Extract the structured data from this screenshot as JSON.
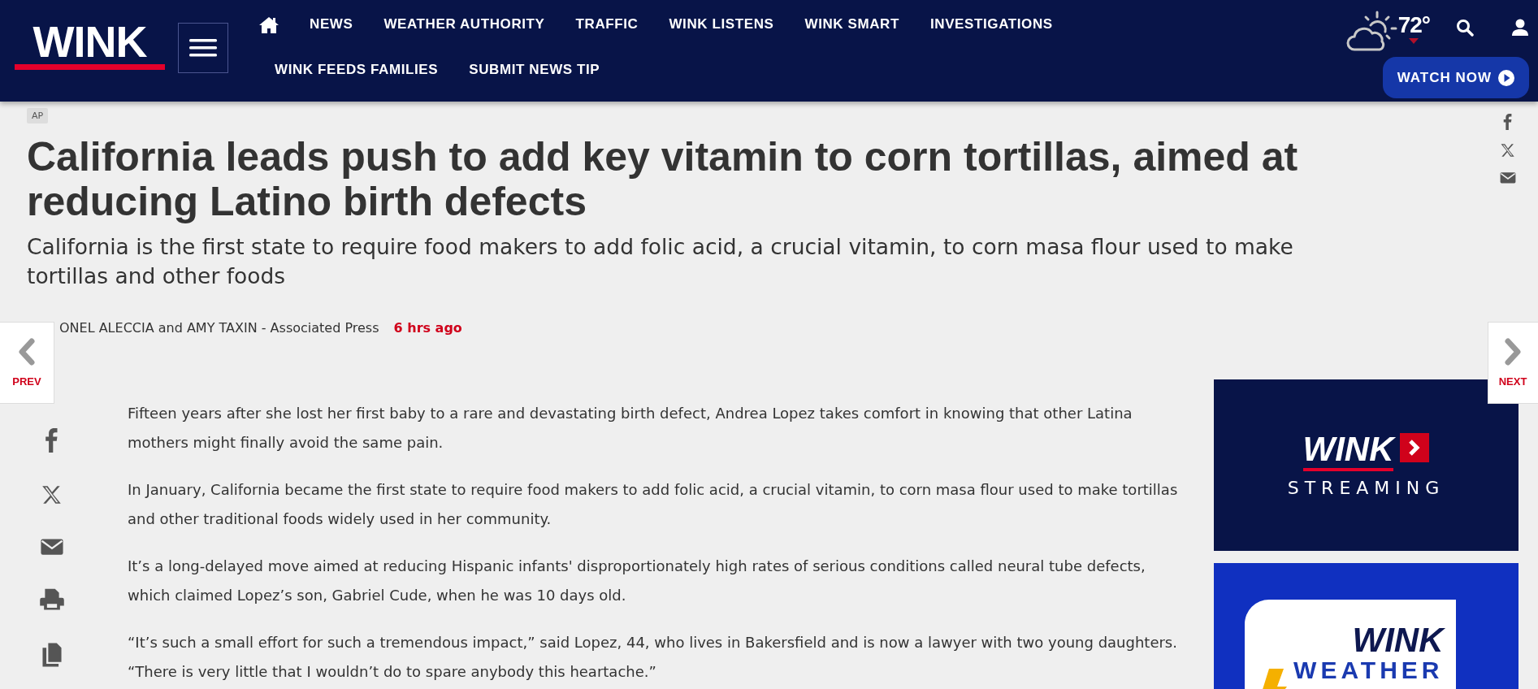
{
  "header": {
    "logo": "WINK",
    "nav": [
      "NEWS",
      "WEATHER AUTHORITY",
      "TRAFFIC",
      "WINK LISTENS",
      "WINK SMART",
      "INVESTIGATIONS",
      "WINK FEEDS FAMILIES",
      "SUBMIT NEWS TIP"
    ],
    "temperature": "72°",
    "watch_button": "WATCH NOW"
  },
  "article": {
    "tag": "AP",
    "headline": "California leads push to add key vitamin to corn tortillas, aimed at reducing Latino birth defects",
    "subtitle": "California is the first state to require food makers to add folic acid, a crucial vitamin, to corn masa flour used to make tortillas and other foods",
    "byline": "ONEL ALECCIA and AMY TAXIN - Associated Press",
    "time": "6 hrs ago",
    "paragraphs": [
      "Fifteen years after she lost her first baby to a rare and devastating birth defect, Andrea Lopez takes comfort in knowing that other Latina mothers might finally avoid the same pain.",
      "In January, California became the first state to require food makers to add folic acid, a crucial vitamin, to corn masa flour used to make tortillas and other traditional foods widely used in her community.",
      "It’s a long-delayed move aimed at reducing Hispanic infants' disproportionately high rates of serious conditions called neural tube defects, which claimed Lopez’s son, Gabriel Cude, when he was 10 days old.",
      "“It’s such a small effort for such a tremendous impact,” said Lopez, 44, who lives in Bakersfield and is now a lawyer with two young daughters. “There is very little that I wouldn’t do to spare anybody this heartache.”"
    ]
  },
  "pager": {
    "prev": "PREV",
    "next": "NEXT"
  },
  "ads": [
    {
      "kind": "streaming",
      "brand": "WINK",
      "label": "STREAMING"
    },
    {
      "kind": "weather",
      "brand": "WINK",
      "label": "WEATHER"
    }
  ]
}
